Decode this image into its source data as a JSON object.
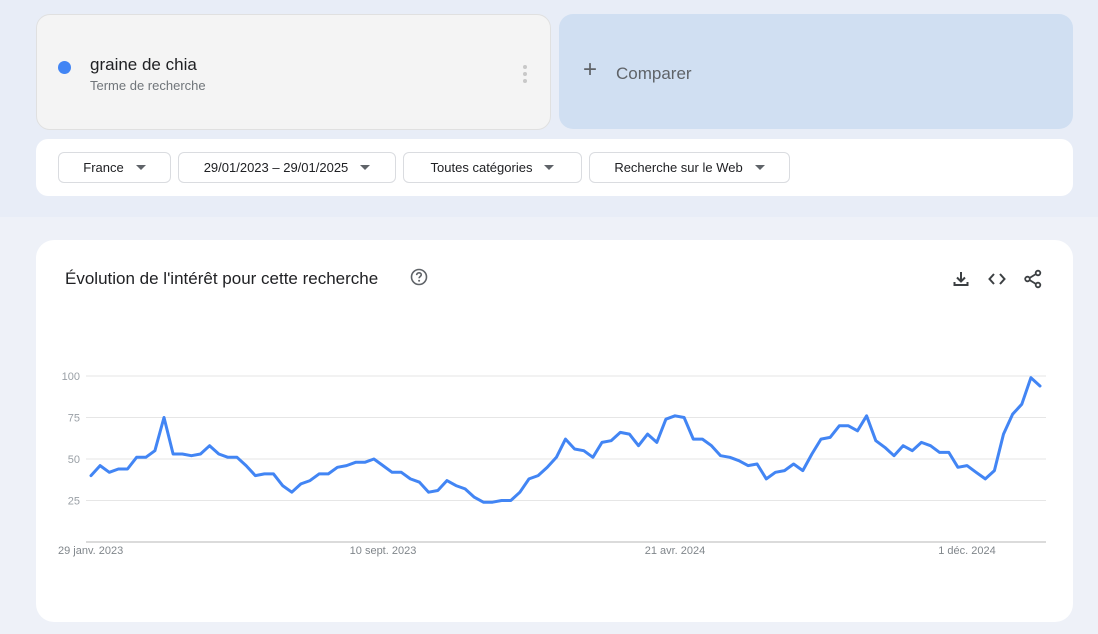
{
  "term": {
    "name": "graine de chia",
    "type": "Terme de recherche",
    "color": "#4285f4"
  },
  "compare": {
    "label": "Comparer"
  },
  "filters": [
    {
      "label": "France"
    },
    {
      "label": "29/01/2023 – 29/01/2025"
    },
    {
      "label": "Toutes catégories"
    },
    {
      "label": "Recherche sur le Web"
    }
  ],
  "chart_card": {
    "title": "Évolution de l'intérêt pour cette recherche",
    "actions": [
      "download-icon",
      "embed-icon",
      "share-icon"
    ]
  },
  "chart_data": {
    "type": "line",
    "title": "Évolution de l'intérêt pour cette recherche",
    "xlabel": "",
    "ylabel": "",
    "ylim": [
      0,
      100
    ],
    "yticks": [
      25,
      50,
      75,
      100
    ],
    "xtick_labels": [
      {
        "label": "29 janv. 2023",
        "index": 0
      },
      {
        "label": "10 sept. 2023",
        "index": 32
      },
      {
        "label": "21 avr. 2024",
        "index": 64
      },
      {
        "label": "1 déc. 2024",
        "index": 96
      }
    ],
    "grid": true,
    "legend": "none",
    "series": [
      {
        "name": "graine de chia",
        "color": "#4285f4",
        "values": [
          40,
          46,
          42,
          44,
          44,
          51,
          51,
          55,
          75,
          53,
          53,
          52,
          53,
          58,
          53,
          51,
          51,
          46,
          40,
          41,
          41,
          34,
          30,
          35,
          37,
          41,
          41,
          45,
          46,
          48,
          48,
          50,
          46,
          42,
          42,
          38,
          36,
          30,
          31,
          37,
          34,
          32,
          27,
          24,
          24,
          25,
          25,
          30,
          38,
          40,
          45,
          51,
          62,
          56,
          55,
          51,
          60,
          61,
          66,
          65,
          58,
          65,
          60,
          74,
          76,
          75,
          62,
          62,
          58,
          52,
          51,
          49,
          46,
          47,
          38,
          42,
          43,
          47,
          43,
          53,
          62,
          63,
          70,
          70,
          67,
          76,
          61,
          57,
          52,
          58,
          55,
          60,
          58,
          54,
          54,
          45,
          46,
          42,
          38,
          43,
          65,
          77,
          83,
          99,
          94
        ]
      }
    ]
  }
}
